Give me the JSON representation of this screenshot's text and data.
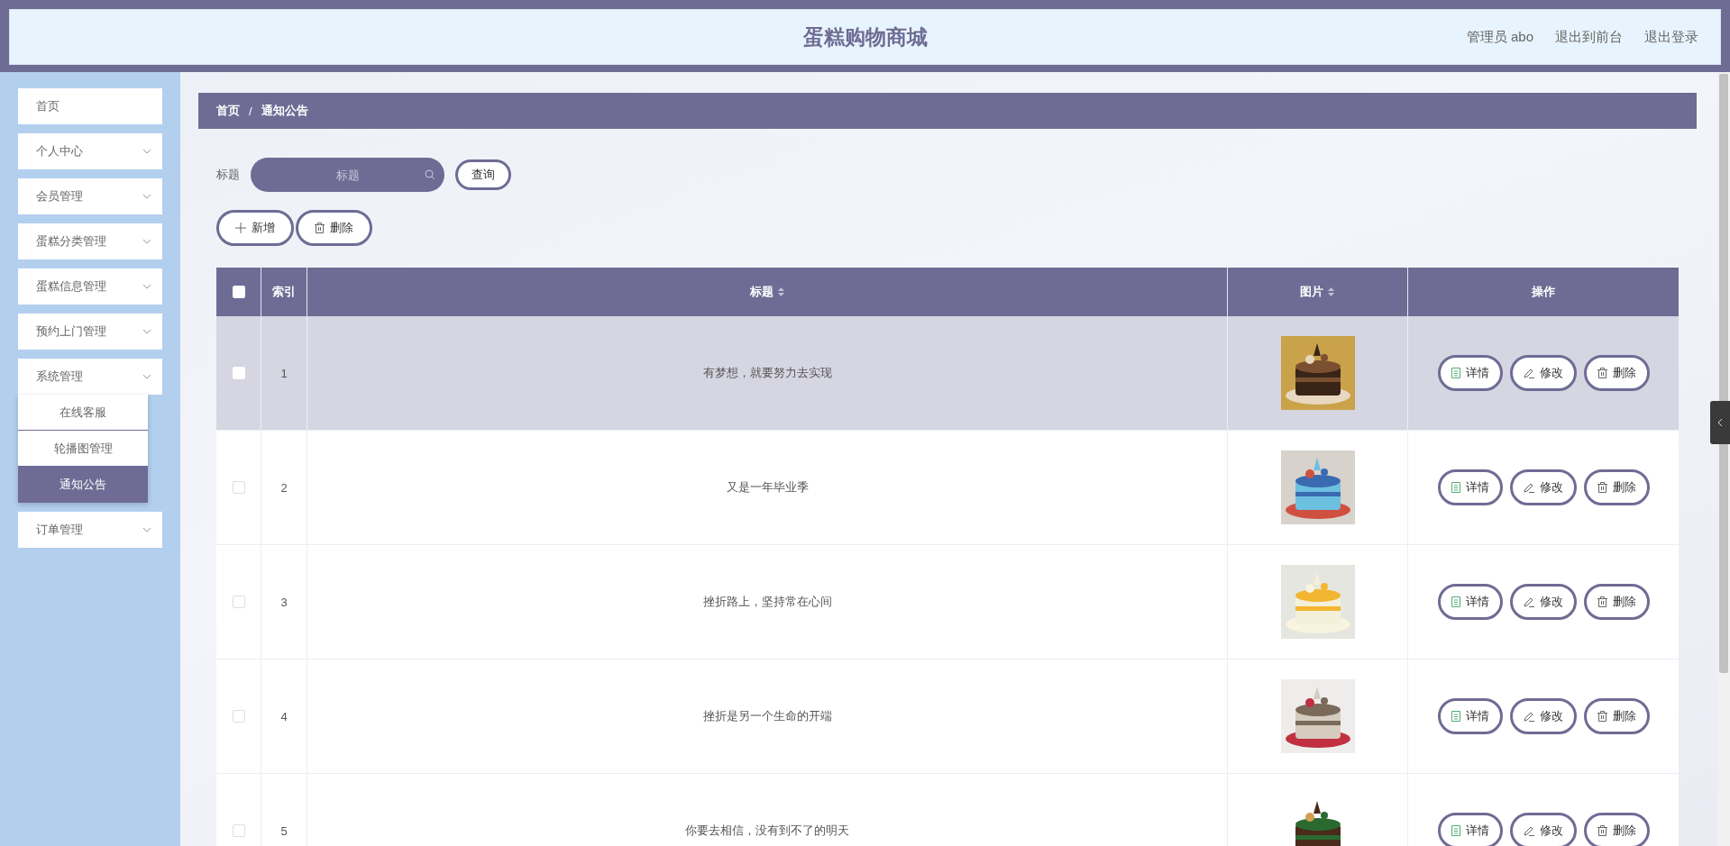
{
  "header": {
    "title": "蛋糕购物商城",
    "links": [
      "管理员 abo",
      "退出到前台",
      "退出登录"
    ]
  },
  "sidebar": {
    "items": [
      {
        "label": "首页",
        "kind": "link"
      },
      {
        "label": "个人中心",
        "kind": "menu"
      },
      {
        "label": "会员管理",
        "kind": "menu"
      },
      {
        "label": "蛋糕分类管理",
        "kind": "menu"
      },
      {
        "label": "蛋糕信息管理",
        "kind": "menu"
      },
      {
        "label": "预约上门管理",
        "kind": "menu"
      },
      {
        "label": "系统管理",
        "kind": "menu",
        "expanded": true,
        "children": [
          {
            "label": "在线客服",
            "selected": false
          },
          {
            "label": "轮播图管理",
            "selected": false
          },
          {
            "label": "通知公告",
            "selected": true
          }
        ]
      },
      {
        "label": "订单管理",
        "kind": "menu"
      }
    ]
  },
  "breadcrumb": {
    "items": [
      "首页",
      "通知公告"
    ],
    "separator": "/"
  },
  "search": {
    "label": "标题",
    "placeholder": "标题",
    "button": "查询"
  },
  "actions": [
    {
      "label": "新增",
      "kind": "add"
    },
    {
      "label": "删除",
      "kind": "delete"
    }
  ],
  "table": {
    "select_all": {
      "checked": false
    },
    "columns": [
      {
        "label": "索引",
        "sortable": false
      },
      {
        "label": "标题",
        "sortable": true
      },
      {
        "label": "图片",
        "sortable": true
      },
      {
        "label": "操作",
        "sortable": false
      }
    ],
    "rows": [
      {
        "index": "1",
        "title": "有梦想，就要努力去实现",
        "checked": false,
        "highlighted": true,
        "image": {
          "kind": "picture"
        },
        "actions": [
          {
            "label": "详情",
            "kind": "detail"
          },
          {
            "label": "修改",
            "kind": "edit"
          },
          {
            "label": "删除",
            "kind": "delete"
          }
        ]
      },
      {
        "index": "2",
        "title": "又是一年毕业季",
        "checked": false,
        "highlighted": false,
        "image": {
          "kind": "picture"
        },
        "actions": [
          {
            "label": "详情",
            "kind": "detail"
          },
          {
            "label": "修改",
            "kind": "edit"
          },
          {
            "label": "删除",
            "kind": "delete"
          }
        ]
      },
      {
        "index": "3",
        "title": "挫折路上，坚持常在心间",
        "checked": false,
        "highlighted": false,
        "image": {
          "kind": "picture"
        },
        "actions": [
          {
            "label": "详情",
            "kind": "detail"
          },
          {
            "label": "修改",
            "kind": "edit"
          },
          {
            "label": "删除",
            "kind": "delete"
          }
        ]
      },
      {
        "index": "4",
        "title": "挫折是另一个生命的开端",
        "checked": false,
        "highlighted": false,
        "image": {
          "kind": "picture"
        },
        "actions": [
          {
            "label": "详情",
            "kind": "detail"
          },
          {
            "label": "修改",
            "kind": "edit"
          },
          {
            "label": "删除",
            "kind": "delete"
          }
        ]
      },
      {
        "index": "5",
        "title": "你要去相信，没有到不了的明天",
        "checked": false,
        "highlighted": false,
        "image": {
          "kind": "picture"
        },
        "actions": [
          {
            "label": "详情",
            "kind": "detail"
          },
          {
            "label": "修改",
            "kind": "edit"
          },
          {
            "label": "删除",
            "kind": "delete"
          }
        ]
      }
    ]
  }
}
